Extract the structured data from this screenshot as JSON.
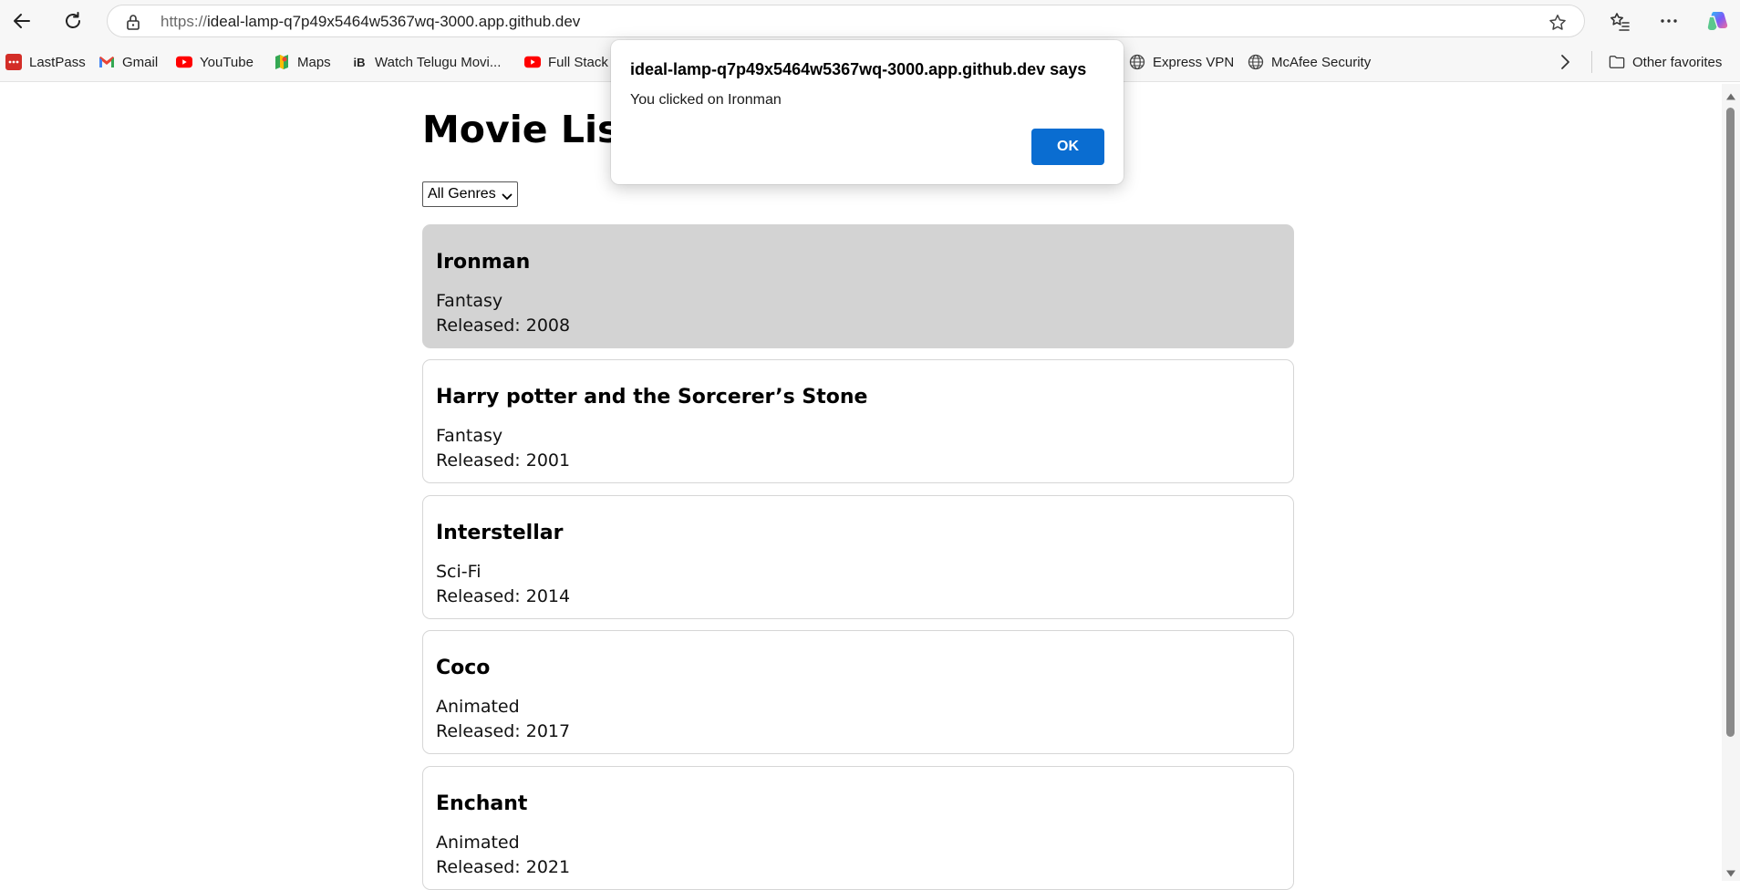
{
  "browser": {
    "url_scheme": "https://",
    "url_host": "ideal-lamp-q7p49x5464w5367wq-3000.app.github.dev",
    "bookmarks": [
      {
        "label": "LastPass",
        "icon": "lastpass-icon"
      },
      {
        "label": "Gmail",
        "icon": "gmail-icon"
      },
      {
        "label": "YouTube",
        "icon": "youtube-icon"
      },
      {
        "label": "Maps",
        "icon": "maps-icon"
      },
      {
        "label": "Watch Telugu Movi...",
        "icon": "ib-icon"
      },
      {
        "label": "Full Stack",
        "icon": "youtube-icon"
      },
      {
        "label": "Express VPN",
        "icon": "globe-icon"
      },
      {
        "label": "McAfee Security",
        "icon": "globe-icon"
      }
    ],
    "other_favorites": "Other favorites"
  },
  "page": {
    "title": "Movie List",
    "genre_filter": {
      "selected": "All Genres"
    },
    "movies": [
      {
        "title": "Ironman",
        "genre": "Fantasy",
        "released": "Released: 2008",
        "selected": true
      },
      {
        "title": "Harry potter and the Sorcerer’s Stone",
        "genre": "Fantasy",
        "released": "Released: 2001"
      },
      {
        "title": "Interstellar",
        "genre": "Sci-Fi",
        "released": "Released: 2014"
      },
      {
        "title": "Coco",
        "genre": "Animated",
        "released": "Released: 2017"
      },
      {
        "title": "Enchant",
        "genre": "Animated",
        "released": "Released: 2021"
      }
    ]
  },
  "dialog": {
    "title": "ideal-lamp-q7p49x5464w5367wq-3000.app.github.dev says",
    "message": "You clicked on Ironman",
    "ok_label": "OK"
  },
  "colors": {
    "selected_card_bg": "#d3d3d3",
    "ok_button": "#0a6dd1"
  }
}
